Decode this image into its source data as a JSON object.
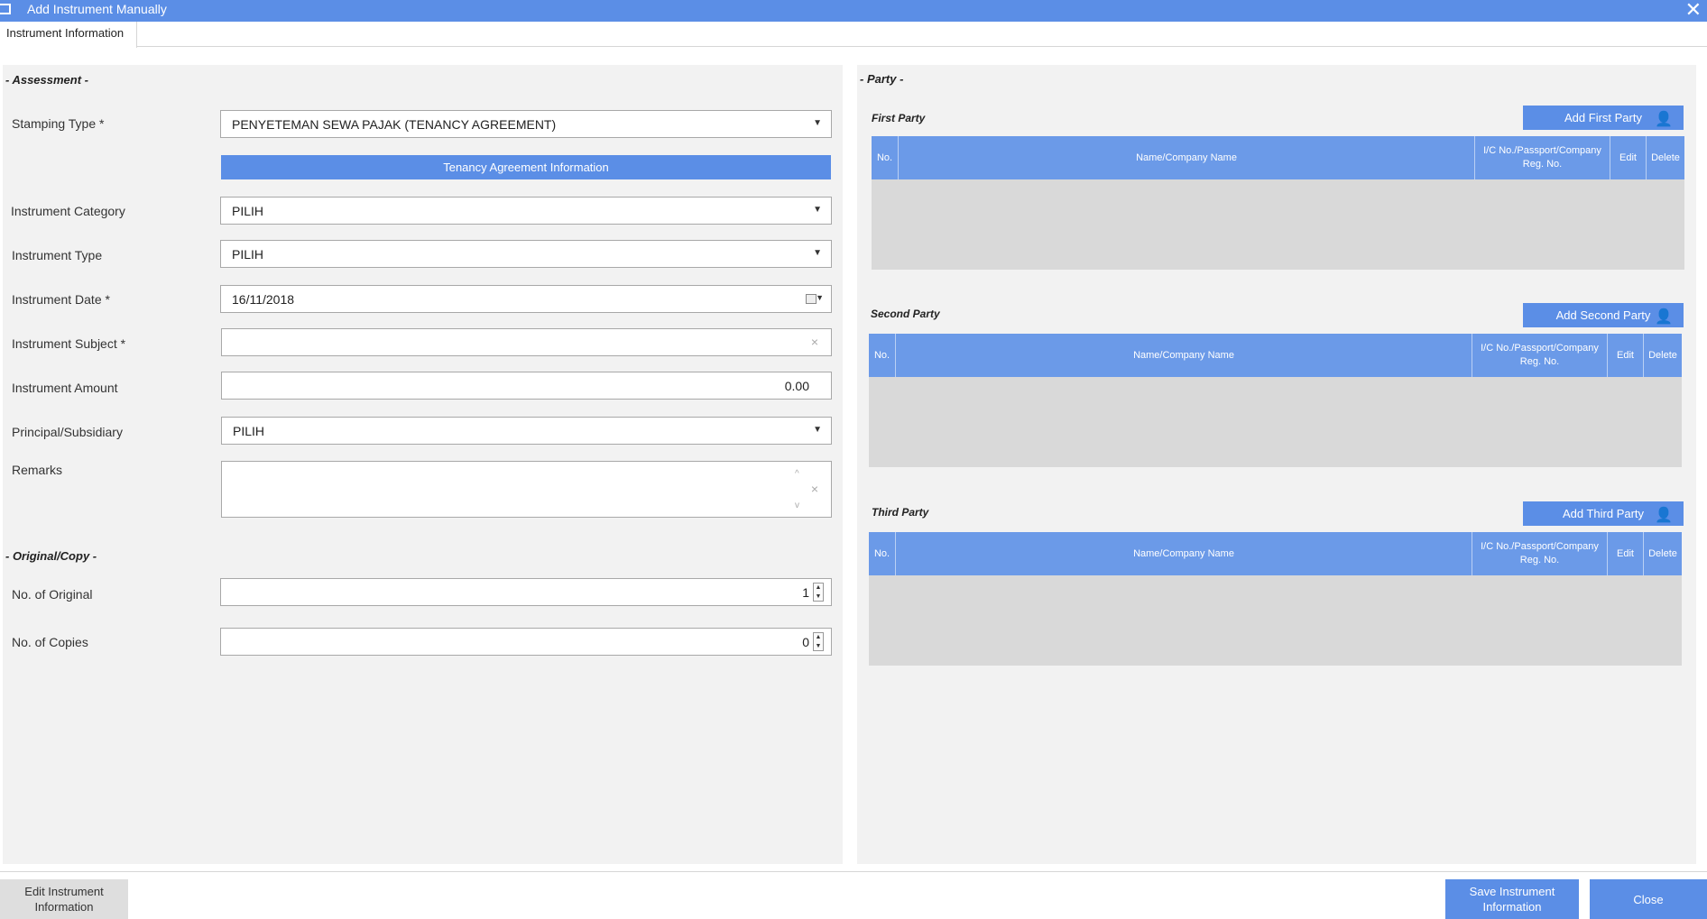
{
  "window": {
    "title": "Add Instrument Manually",
    "close_glyph": "✕"
  },
  "tabs": [
    {
      "label": "Instrument Information"
    }
  ],
  "assessment": {
    "section_title": "- Assessment -",
    "stamping_type": {
      "label": "Stamping Type *",
      "value": "PENYETEMAN SEWA PAJAK (TENANCY AGREEMENT)"
    },
    "tenancy_button": "Tenancy Agreement Information",
    "instrument_category": {
      "label": "Instrument Category",
      "value": "PILIH"
    },
    "instrument_type": {
      "label": "Instrument Type",
      "value": "PILIH"
    },
    "instrument_date": {
      "label": "Instrument Date *",
      "value": "16/11/2018"
    },
    "instrument_subject": {
      "label": "Instrument Subject *",
      "value": ""
    },
    "instrument_amount": {
      "label": "Instrument Amount",
      "value": "0.00"
    },
    "principal_subsidiary": {
      "label": "Principal/Subsidiary",
      "value": "PILIH"
    },
    "remarks": {
      "label": "Remarks",
      "value": ""
    }
  },
  "original_copy": {
    "section_title": "- Original/Copy -",
    "no_of_original": {
      "label": "No. of Original",
      "value": "1"
    },
    "no_of_copies": {
      "label": "No. of Copies",
      "value": "0"
    }
  },
  "party": {
    "section_title": "- Party -",
    "columns": {
      "no": "No.",
      "name": "Name/Company Name",
      "ic": "I/C No./Passport/Company Reg. No.",
      "edit": "Edit",
      "delete": "Delete"
    },
    "first": {
      "title": "First Party",
      "button": "Add First Party"
    },
    "second": {
      "title": "Second Party",
      "button": "Add Second Party"
    },
    "third": {
      "title": "Third Party",
      "button": "Add Third Party"
    }
  },
  "footer": {
    "edit_button": "Edit Instrument Information",
    "save_button": "Save Instrument Information",
    "close_button": "Close"
  },
  "colors": {
    "accent": "#5b8ee6",
    "grid_header": "#6b9ae8",
    "panel": "#f2f2f2",
    "grid_body": "#d9d9d9"
  }
}
